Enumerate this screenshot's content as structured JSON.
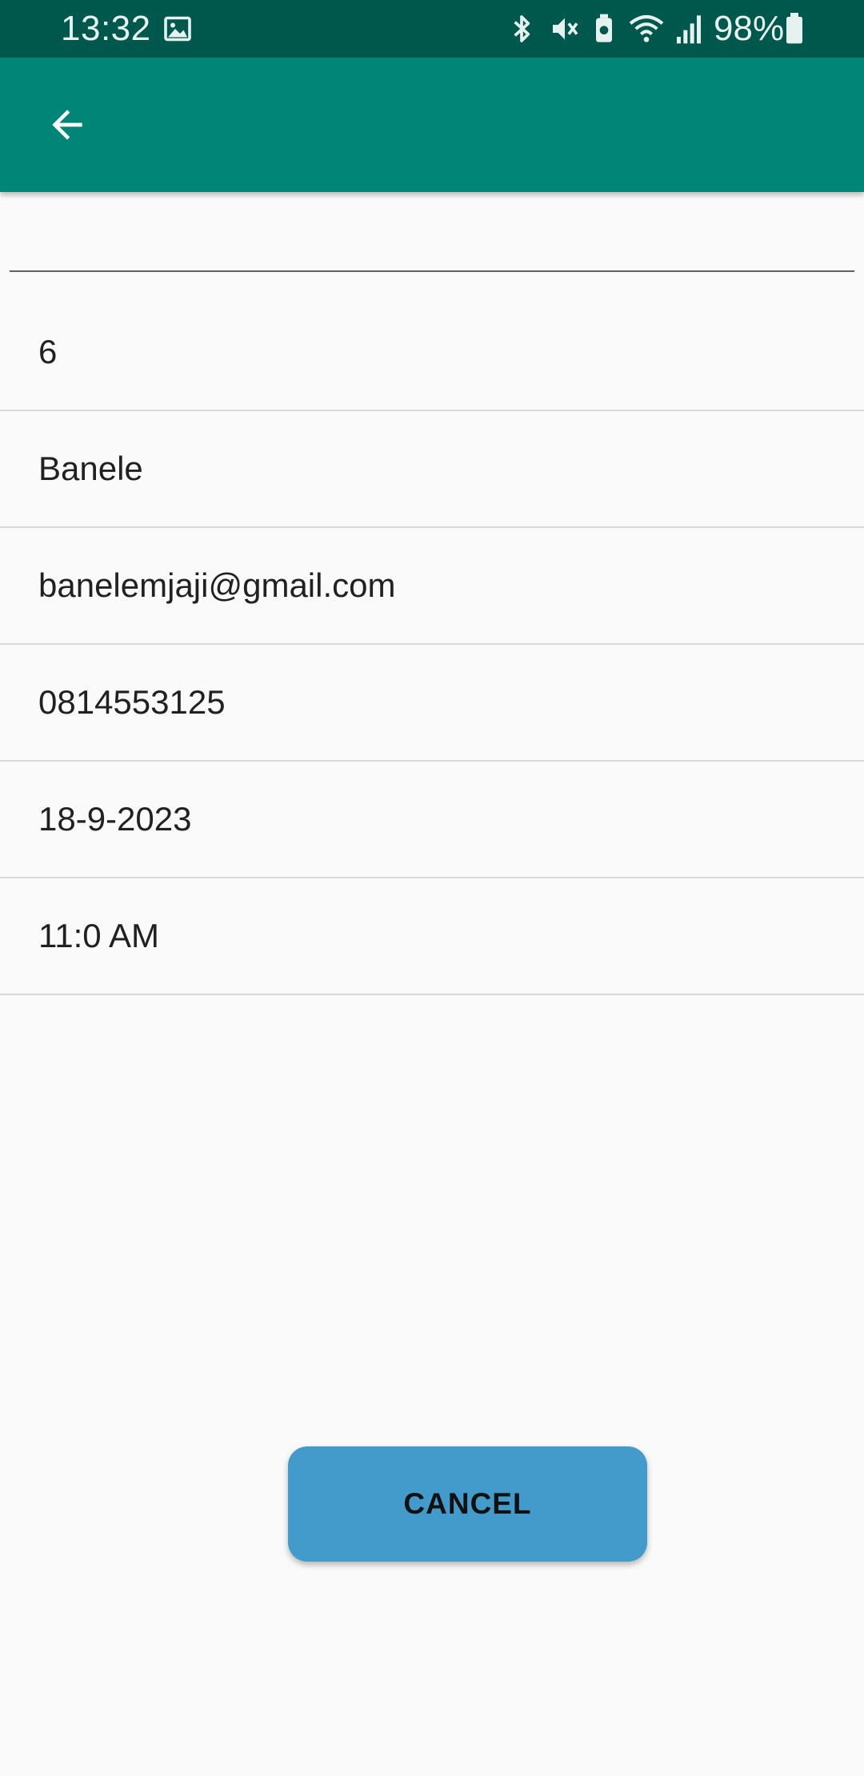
{
  "status_bar": {
    "time": "13:32",
    "battery_percent": "98%",
    "icons": [
      "image-icon",
      "bluetooth-icon",
      "mute-vibrate-icon",
      "battery-saver-icon",
      "wifi-icon",
      "signal-icon",
      "battery-icon"
    ]
  },
  "app_bar": {
    "back_icon": "arrow-back-icon"
  },
  "input": {
    "value": "",
    "placeholder": ""
  },
  "details": [
    {
      "value": "6"
    },
    {
      "value": "Banele"
    },
    {
      "value": "banelemjaji@gmail.com"
    },
    {
      "value": "0814553125"
    },
    {
      "value": "18-9-2023"
    },
    {
      "value": "11:0 AM"
    }
  ],
  "actions": {
    "cancel_label": "CANCEL"
  },
  "colors": {
    "status_bar": "#00574b",
    "app_bar": "#008577",
    "button": "#429bca",
    "background": "#fafafa"
  }
}
